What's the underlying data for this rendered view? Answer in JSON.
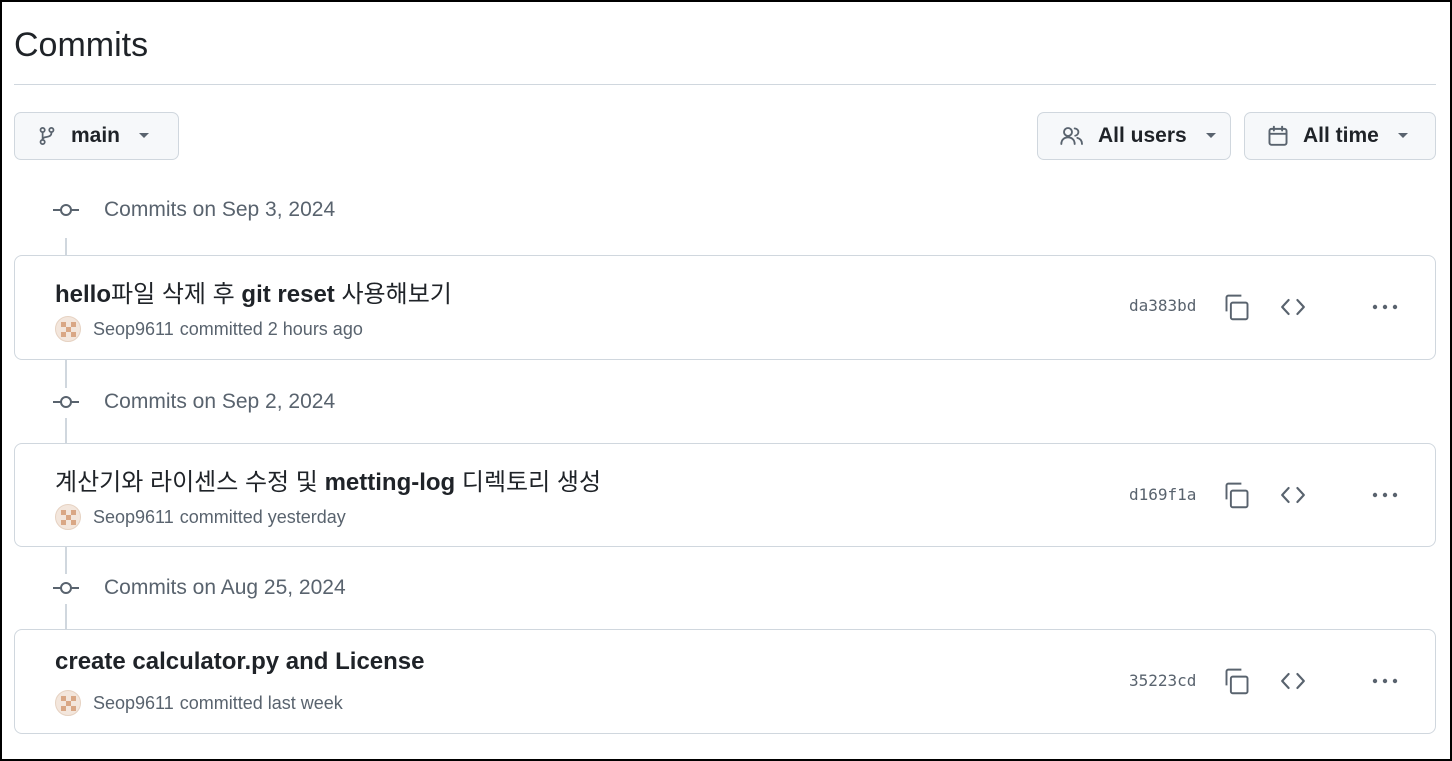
{
  "page": {
    "title": "Commits"
  },
  "toolbar": {
    "branch_label": "main",
    "users_label": "All users",
    "time_label": "All time"
  },
  "groups": [
    {
      "date_label": "Commits on Sep 3, 2024",
      "commit": {
        "message_parts": [
          "hello",
          "파일 삭제 후 ",
          "git reset",
          " 사용해보기"
        ],
        "author": "Seop9611",
        "committed_text": "committed 2 hours ago",
        "sha": "da383bd"
      }
    },
    {
      "date_label": "Commits on Sep 2, 2024",
      "commit": {
        "message_parts": [
          "",
          "계산기와 라이센스 수정 및 ",
          "metting-log",
          " 디렉토리 생성"
        ],
        "author": "Seop9611",
        "committed_text": "committed yesterday",
        "sha": "d169f1a"
      }
    },
    {
      "date_label": "Commits on Aug 25, 2024",
      "commit": {
        "message_parts": [
          "create calculator.py and License",
          "",
          "",
          ""
        ],
        "author": "Seop9611",
        "committed_text": "committed last week",
        "sha": "35223cd"
      }
    }
  ],
  "icons": {
    "branch": "git-branch-icon",
    "users": "people-icon",
    "calendar": "calendar-icon",
    "caret": "triangle-down-icon",
    "commit_node": "git-commit-icon",
    "copy": "copy-icon",
    "browse": "code-icon",
    "more": "kebab-horizontal-icon"
  },
  "colors": {
    "border": "#d0d7de",
    "muted_text": "#59636e",
    "button_bg": "#f6f8fa",
    "text": "#1f2328"
  }
}
